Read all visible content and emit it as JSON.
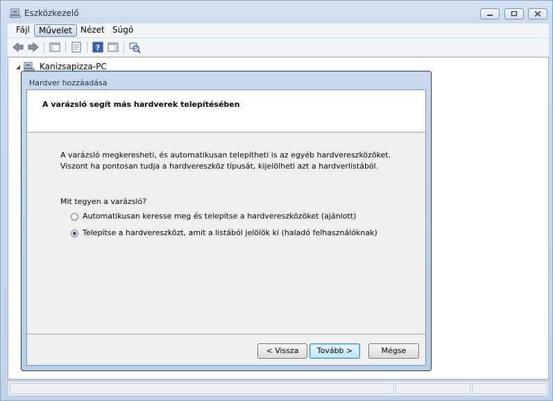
{
  "window": {
    "title": "Eszközkezelő",
    "caption_buttons": [
      "minimize-icon",
      "maximize-icon",
      "close-icon"
    ]
  },
  "menu": [
    "Fájl",
    "Művelet",
    "Nézet",
    "Súgó"
  ],
  "toolbar_icons": [
    "back-icon",
    "forward-icon",
    "console-tree-icon",
    "properties-icon",
    "help-icon",
    "action-pane-icon",
    "scan-hardware-icon"
  ],
  "tree": {
    "root_label": "Kanizsapizza-PC"
  },
  "dialog": {
    "title": "Hardver hozzáadása",
    "heading": "A varázsló segít más hardverek telepítésében",
    "intro_line1": "A varázsló megkeresheti, és automatikusan telepítheti is az egyéb hardvereszközöket.",
    "intro_line2": "Viszont ha pontosan tudja a hardvereszköz típusát, kijelölheti azt a hardverlistából.",
    "question": "Mit tegyen a varázsló?",
    "options": [
      {
        "label": "Automatikusan keresse meg és telepítse a hardvereszközöket (ajánlott)",
        "selected": false
      },
      {
        "label": "Telepítse a hardvereszközt, amit a listából jelölök ki (haladó felhasználóknak)",
        "selected": true
      }
    ],
    "buttons": {
      "back": "< Vissza",
      "next": "Tovább >",
      "cancel": "Mégse"
    }
  }
}
